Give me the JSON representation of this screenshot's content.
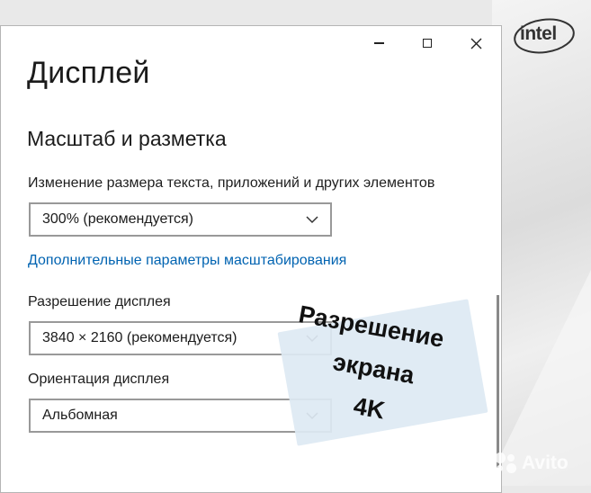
{
  "window": {
    "controls": {
      "minimize_icon": "minimize-icon",
      "maximize_icon": "maximize-icon",
      "close_icon": "close-icon"
    }
  },
  "page_title": "Дисплей",
  "section_title": "Масштаб и разметка",
  "scale": {
    "label": "Изменение размера текста, приложений и других элементов",
    "selected": "300% (рекомендуется)"
  },
  "advanced_scaling_link": "Дополнительные параметры масштабирования",
  "resolution": {
    "label": "Разрешение дисплея",
    "selected": "3840 × 2160 (рекомендуется)"
  },
  "orientation": {
    "label": "Ориентация дисплея",
    "selected": "Альбомная"
  },
  "sticker": {
    "line1": "Разрешение",
    "line2": "экрана",
    "line3": "4K"
  },
  "logo": {
    "text": "intel"
  },
  "watermark": {
    "text": "Avito"
  },
  "colors": {
    "link": "#0063b1",
    "sticker_bg": "#dde9f3",
    "window_bg": "#ffffff"
  }
}
